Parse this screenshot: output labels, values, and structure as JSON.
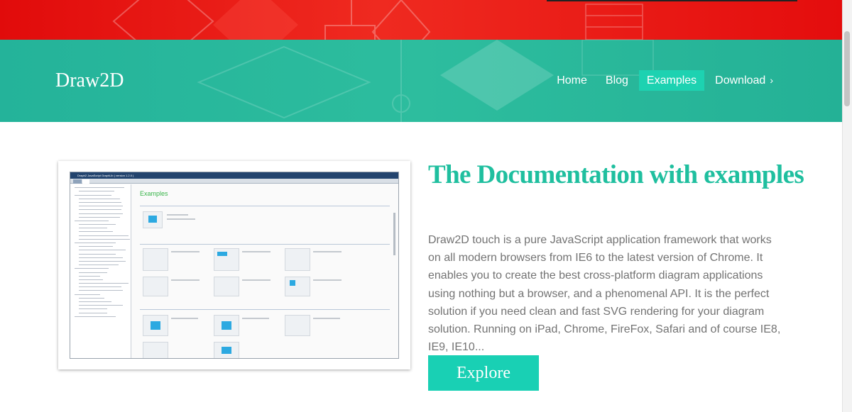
{
  "header": {
    "brand": "Draw2D",
    "nav": [
      {
        "label": "Home",
        "active": false
      },
      {
        "label": "Blog",
        "active": false
      },
      {
        "label": "Examples",
        "active": true
      },
      {
        "label": "Download",
        "active": false
      }
    ],
    "download_chevron": "›"
  },
  "main": {
    "title": "The Documentation with examples",
    "description": "Draw2D touch is a pure JavaScript application framework that works on all modern browsers from IE6 to the latest version of Chrome. It enables you to create the best cross-platform diagram applications using nothing but a browser, and a phenomenal API. It is the perfect solution if you need clean and fast SVG rendering for your diagram solution. Running on iPad, Chrome, FireFox, Safari and of course IE8, IE9, IE10...",
    "explore_label": "Explore"
  },
  "screenshot": {
    "app_title": "Draph2 JavaScript GraphLib ( version 1.2.0 )",
    "heading": "Examples"
  },
  "colors": {
    "hero_red": "#e10b0b",
    "header_teal": "#2dbd9e",
    "active_nav": "#1dd2b1",
    "title_teal": "#1fbf9f",
    "button": "#19d0b4",
    "body_text": "#737373"
  }
}
